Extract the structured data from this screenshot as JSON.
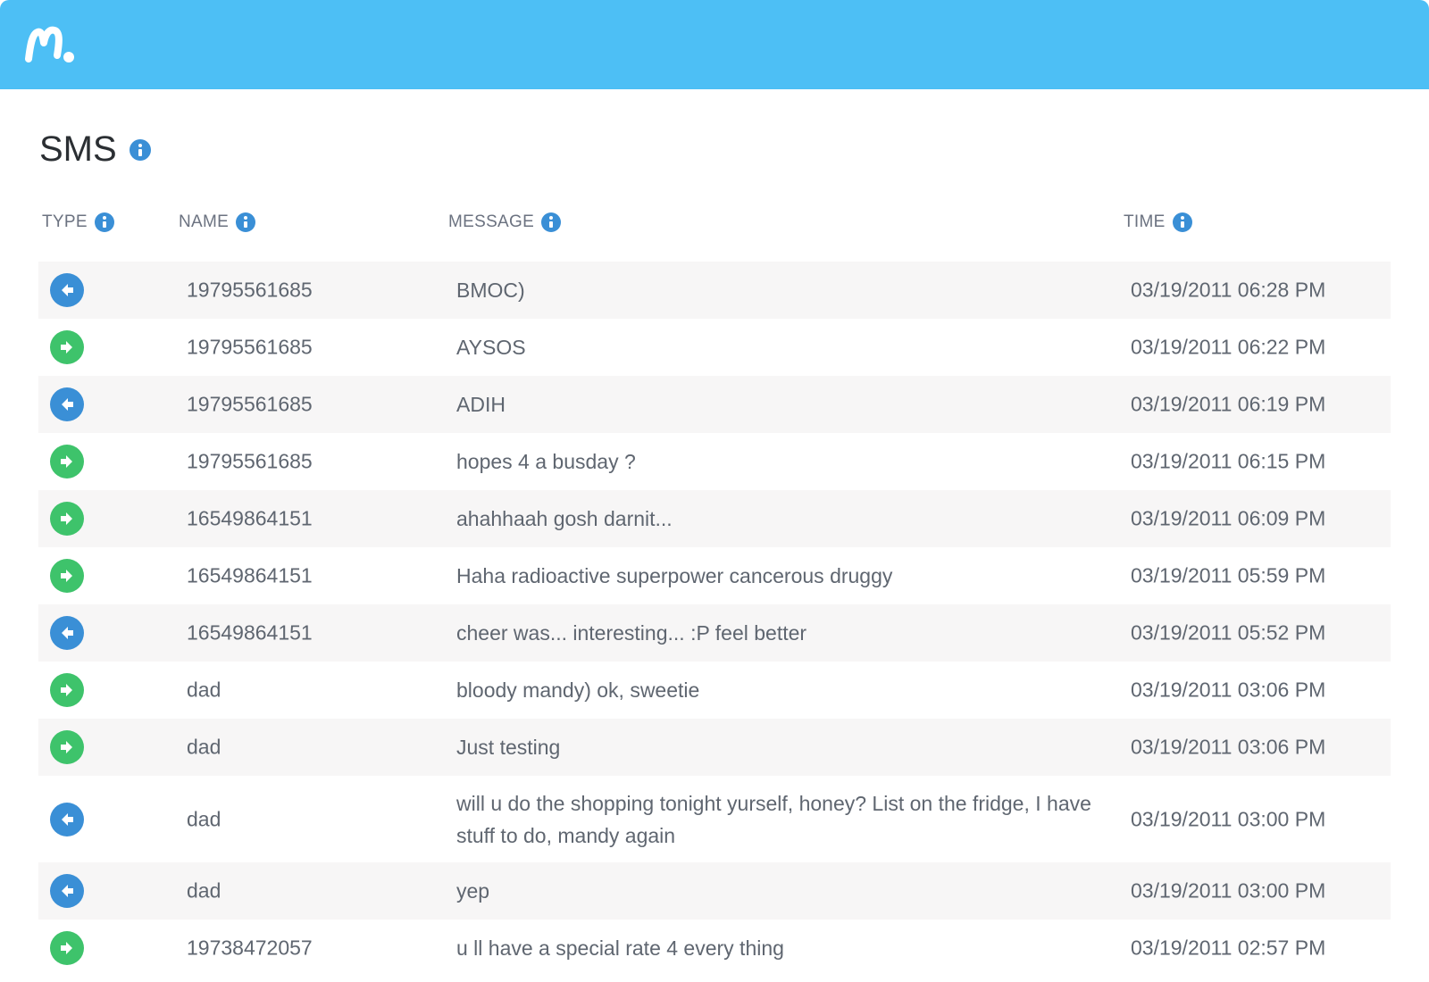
{
  "header": {
    "logo_icon": "mspy-logo-icon",
    "bg_color": "#4dbff5"
  },
  "page": {
    "title": "SMS",
    "title_info_icon": "info-icon"
  },
  "table": {
    "columns": [
      {
        "key": "type",
        "label": "TYPE"
      },
      {
        "key": "name",
        "label": "NAME"
      },
      {
        "key": "message",
        "label": "MESSAGE"
      },
      {
        "key": "time",
        "label": "TIME"
      }
    ],
    "icon_colors": {
      "incoming": "#3a8fd6",
      "outgoing": "#3ec36b"
    },
    "rows": [
      {
        "type": "incoming",
        "name": "19795561685",
        "message": "BMOC)",
        "time": "03/19/2011 06:28 PM"
      },
      {
        "type": "outgoing",
        "name": "19795561685",
        "message": "AYSOS",
        "time": "03/19/2011 06:22 PM"
      },
      {
        "type": "incoming",
        "name": "19795561685",
        "message": "ADIH",
        "time": "03/19/2011 06:19 PM"
      },
      {
        "type": "outgoing",
        "name": "19795561685",
        "message": "hopes 4 a busday ?",
        "time": "03/19/2011 06:15 PM"
      },
      {
        "type": "outgoing",
        "name": "16549864151",
        "message": "ahahhaah gosh darnit...",
        "time": "03/19/2011 06:09 PM"
      },
      {
        "type": "outgoing",
        "name": "16549864151",
        "message": "Haha radioactive superpower cancerous druggy",
        "time": "03/19/2011 05:59 PM"
      },
      {
        "type": "incoming",
        "name": "16549864151",
        "message": "cheer was... interesting... :P feel better",
        "time": "03/19/2011 05:52 PM"
      },
      {
        "type": "outgoing",
        "name": "dad",
        "message": "bloody mandy) ok, sweetie",
        "time": "03/19/2011 03:06 PM"
      },
      {
        "type": "outgoing",
        "name": "dad",
        "message": "Just testing",
        "time": "03/19/2011 03:06 PM"
      },
      {
        "type": "incoming",
        "name": "dad",
        "message": "will u do the shopping tonight yurself, honey? List on the fridge, I have stuff to do, mandy again",
        "time": "03/19/2011 03:00 PM"
      },
      {
        "type": "incoming",
        "name": "dad",
        "message": "yep",
        "time": "03/19/2011 03:00 PM"
      },
      {
        "type": "outgoing",
        "name": "19738472057",
        "message": "u ll have a special rate 4 every thing",
        "time": "03/19/2011 02:57 PM"
      }
    ]
  }
}
